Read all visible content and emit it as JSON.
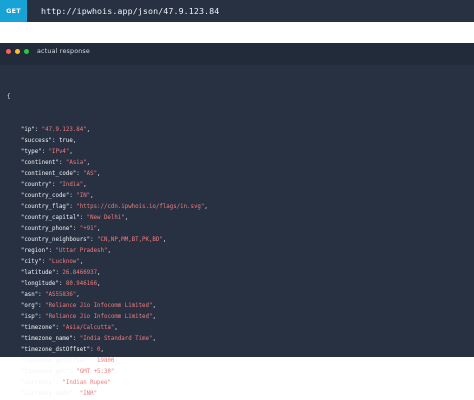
{
  "request": {
    "method": "GET",
    "url": "http://ipwhois.app/json/47.9.123.84"
  },
  "panel": {
    "title": "actual response"
  },
  "response": {
    "open": "{",
    "lines": [
      {
        "key": "\"ip\"",
        "value": "\"47.9.123.84\"",
        "type": "string"
      },
      {
        "key": "\"success\"",
        "value": "true",
        "type": "literal"
      },
      {
        "key": "\"type\"",
        "value": "\"IPv4\"",
        "type": "string"
      },
      {
        "key": "\"continent\"",
        "value": "\"Asia\"",
        "type": "string"
      },
      {
        "key": "\"continent_code\"",
        "value": "\"AS\"",
        "type": "string"
      },
      {
        "key": "\"country\"",
        "value": "\"India\"",
        "type": "string"
      },
      {
        "key": "\"country_code\"",
        "value": "\"IN\"",
        "type": "string"
      },
      {
        "key": "\"country_flag\"",
        "value": "\"https://cdn.ipwhois.io/flags/in.svg\"",
        "type": "string"
      },
      {
        "key": "\"country_capital\"",
        "value": "\"New Delhi\"",
        "type": "string"
      },
      {
        "key": "\"country_phone\"",
        "value": "\"+91\"",
        "type": "string"
      },
      {
        "key": "\"country_neighbours\"",
        "value": "\"CN,NP,MM,BT,PK,BD\"",
        "type": "string"
      },
      {
        "key": "\"region\"",
        "value": "\"Uttar Pradesh\"",
        "type": "string"
      },
      {
        "key": "\"city\"",
        "value": "\"Lucknow\"",
        "type": "string"
      },
      {
        "key": "\"latitude\"",
        "value": "26.8466937",
        "type": "number"
      },
      {
        "key": "\"longitude\"",
        "value": "80.946166",
        "type": "number"
      },
      {
        "key": "\"asn\"",
        "value": "\"AS55836\"",
        "type": "string"
      },
      {
        "key": "\"org\"",
        "value": "\"Reliance Jio Infocomm Limited\"",
        "type": "string"
      },
      {
        "key": "\"isp\"",
        "value": "\"Reliance Jio Infocomm Limited\"",
        "type": "string"
      },
      {
        "key": "\"timezone\"",
        "value": "\"Asia/Calcutta\"",
        "type": "string"
      },
      {
        "key": "\"timezone_name\"",
        "value": "\"India Standard Time\"",
        "type": "string"
      },
      {
        "key": "\"timezone_dstOffset\"",
        "value": "0",
        "type": "number"
      },
      {
        "key": "\"timezone_gmtOffset\"",
        "value": "19800",
        "type": "number"
      },
      {
        "key": "\"timezone_gmt\"",
        "value": "\"GMT +5:30\"",
        "type": "string"
      },
      {
        "key": "\"currency\"",
        "value": "\"Indian Rupee\"",
        "type": "string"
      },
      {
        "key": "\"currency_code\"",
        "value": "\"INR\"",
        "type": "string"
      }
    ]
  },
  "colors": {
    "bar_bg": "#273142",
    "method_bg": "#18a3d6",
    "panel_head_bg": "#222b39",
    "value_color": "#f07c7c",
    "dot_red": "#ff5f56",
    "dot_yellow": "#ffbd2e",
    "dot_green": "#27c93f"
  }
}
